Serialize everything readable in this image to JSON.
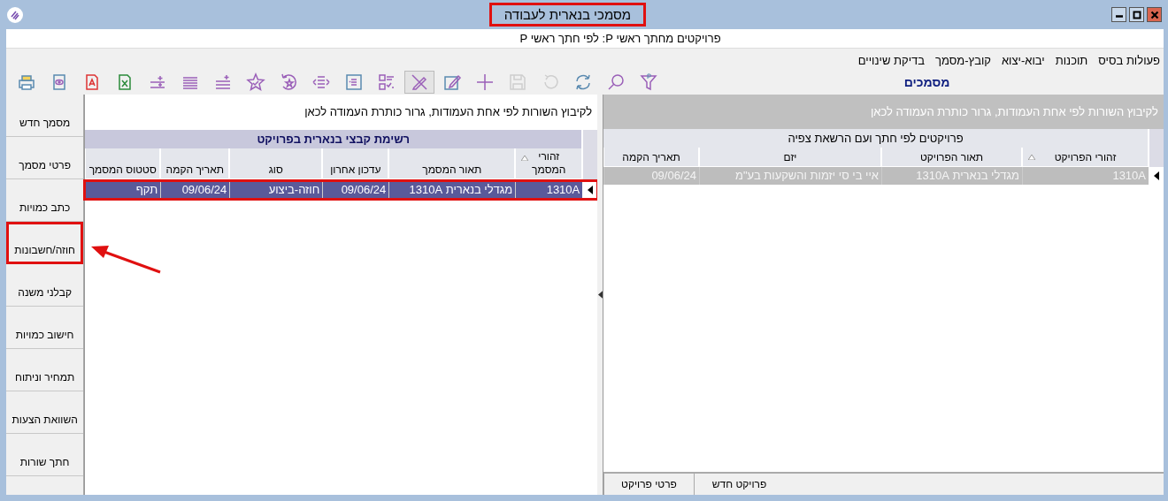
{
  "window": {
    "title": "מסמכי בנארית לעבודה",
    "highlighted": true
  },
  "subtitle": "פרויקטים מחתך ראשי P: לפי חתך ראשי P",
  "menu": [
    "פעולות בסיס",
    "תוכנות",
    "יבוא-יצוא",
    "קובץ-מסמך",
    "בדיקת שינויים"
  ],
  "toolbar": [
    {
      "kind": "print",
      "disabled": false,
      "selected": false
    },
    {
      "kind": "preview",
      "disabled": false,
      "selected": false
    },
    {
      "kind": "pdf",
      "disabled": false,
      "selected": false
    },
    {
      "kind": "excel",
      "disabled": false,
      "selected": false
    },
    {
      "kind": "add-lines",
      "disabled": false,
      "selected": false
    },
    {
      "kind": "lines",
      "disabled": false,
      "selected": false
    },
    {
      "kind": "lines-plus",
      "disabled": false,
      "selected": false
    },
    {
      "kind": "star-check",
      "disabled": false,
      "selected": false
    },
    {
      "kind": "star-undo",
      "disabled": false,
      "selected": false
    },
    {
      "kind": "expand",
      "disabled": false,
      "selected": false
    },
    {
      "kind": "frame",
      "disabled": false,
      "selected": false
    },
    {
      "kind": "checklist",
      "disabled": false,
      "selected": false
    },
    {
      "kind": "pencil-off",
      "disabled": false,
      "selected": true
    },
    {
      "kind": "edit",
      "disabled": false,
      "selected": false
    },
    {
      "kind": "add",
      "disabled": false,
      "selected": false
    },
    {
      "kind": "save",
      "disabled": true,
      "selected": false
    },
    {
      "kind": "undo",
      "disabled": true,
      "selected": false
    },
    {
      "kind": "refresh",
      "disabled": false,
      "selected": false
    },
    {
      "kind": "search",
      "disabled": false,
      "selected": false
    },
    {
      "kind": "filter",
      "disabled": false,
      "selected": false
    }
  ],
  "panel_title": "מסמכים",
  "sidebar": {
    "items": [
      {
        "label": "מסמך חדש",
        "highlighted": false
      },
      {
        "label": "פרטי מסמך",
        "highlighted": false
      },
      {
        "label": "כתב כמויות",
        "highlighted": false
      },
      {
        "label": "חוזה/חשבונות",
        "highlighted": true
      },
      {
        "label": "קבלני משנה",
        "highlighted": false
      },
      {
        "label": "חישוב כמויות",
        "highlighted": false
      },
      {
        "label": "תמחיר וניתוח",
        "highlighted": false
      },
      {
        "label": "השוואת הצעות",
        "highlighted": false
      },
      {
        "label": "חתך שורות",
        "highlighted": false
      }
    ]
  },
  "documents_grid": {
    "group_hint": "לקיבוץ השורות לפי אחת העמודות, גרור כותרת העמודה לכאן",
    "band": "רשימת קבצי בנארית בפרויקט",
    "columns": [
      {
        "label": "זהורי המסמך",
        "sorted": true
      },
      {
        "label": "תאור המסמך",
        "sorted": false
      },
      {
        "label": "עדכון אחרון",
        "sorted": false
      },
      {
        "label": "סוג",
        "sorted": false
      },
      {
        "label": "תאריך הקמה",
        "sorted": false
      },
      {
        "label": "סטטוס המסמך",
        "sorted": false
      }
    ],
    "rows": [
      {
        "cells": [
          "1310A",
          "מגדלי בנארית 1310A",
          "09/06/24",
          "חוזה-ביצוע",
          "09/06/24",
          "תקף"
        ],
        "selected": true,
        "highlighted": true
      }
    ]
  },
  "projects_grid": {
    "group_hint": "לקיבוץ השורות לפי אחת העמודות, גרור כותרת העמודה לכאן",
    "band": "פרויקטים לפי חתך ועם הרשאת צפיה",
    "columns": [
      {
        "label": "זהורי הפרויקט",
        "sorted": true
      },
      {
        "label": "תאור הפרויקט",
        "sorted": false
      },
      {
        "label": "יזם",
        "sorted": false
      },
      {
        "label": "תאריך הקמה",
        "sorted": false
      }
    ],
    "rows": [
      {
        "cells": [
          "1310A",
          "מגדלי בנארית 1310A",
          "איי בי סי יזמות והשקעות בע\"מ",
          "09/06/24"
        ],
        "selected": false,
        "highlighted": false
      }
    ]
  },
  "project_buttons": [
    "פרויקט חדש",
    "פרטי פרויקט"
  ]
}
